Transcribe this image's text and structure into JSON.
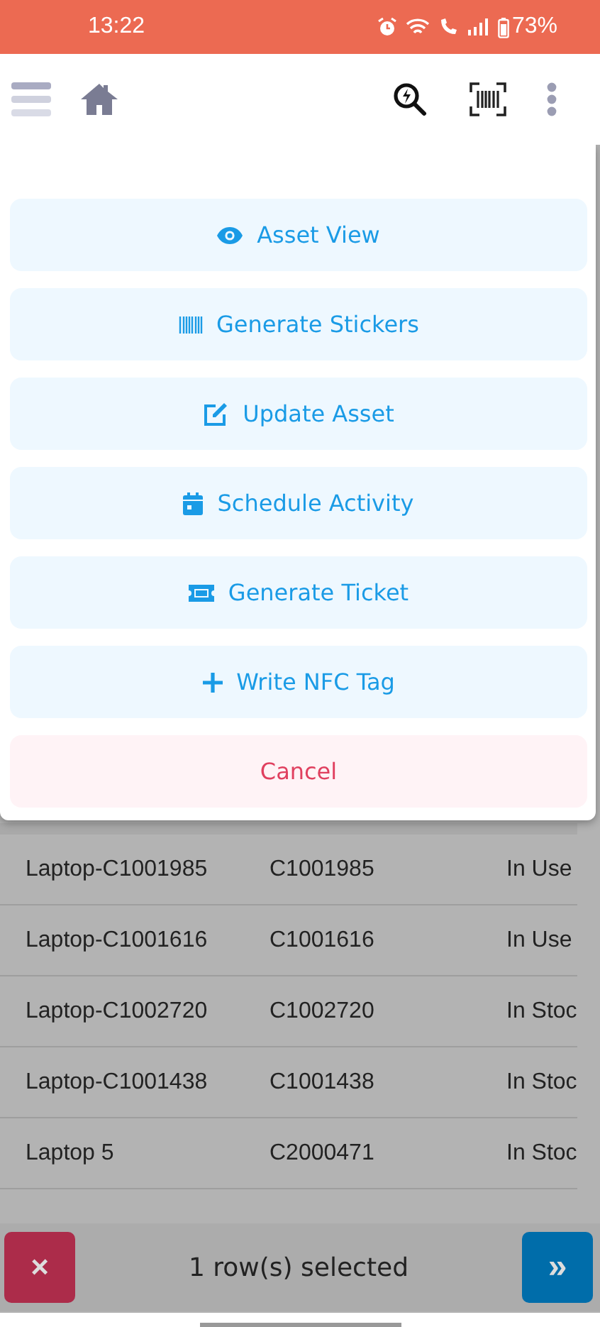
{
  "status_bar": {
    "time": "13:22",
    "battery": "73%"
  },
  "action_sheet": {
    "actions": [
      {
        "label": "Asset View",
        "kind": "eye"
      },
      {
        "label": "Generate Stickers",
        "kind": "barcode"
      },
      {
        "label": "Update Asset",
        "kind": "edit"
      },
      {
        "label": "Schedule Activity",
        "kind": "calendar"
      },
      {
        "label": "Generate Ticket",
        "kind": "ticket"
      },
      {
        "label": "Write NFC Tag",
        "kind": "plus"
      }
    ],
    "cancel": "Cancel"
  },
  "table": {
    "rows": [
      {
        "column_1": "Laptop-C1001985",
        "column_2": "C1001985",
        "column_3": "In Use"
      },
      {
        "column_1": "Laptop-C1001616",
        "column_2": "C1001616",
        "column_3": "In Use"
      },
      {
        "column_1": "Laptop-C1002720",
        "column_2": "C1002720",
        "column_3": "In Stoc"
      },
      {
        "column_1": "Laptop-C1001438",
        "column_2": "C1001438",
        "column_3": "In Stoc"
      },
      {
        "column_1": "Laptop 5",
        "column_2": "C2000471",
        "column_3": "In Stoc"
      }
    ]
  },
  "selection_bar": {
    "clear_button": "×",
    "text": "1 row(s) selected",
    "next_button": "»"
  }
}
